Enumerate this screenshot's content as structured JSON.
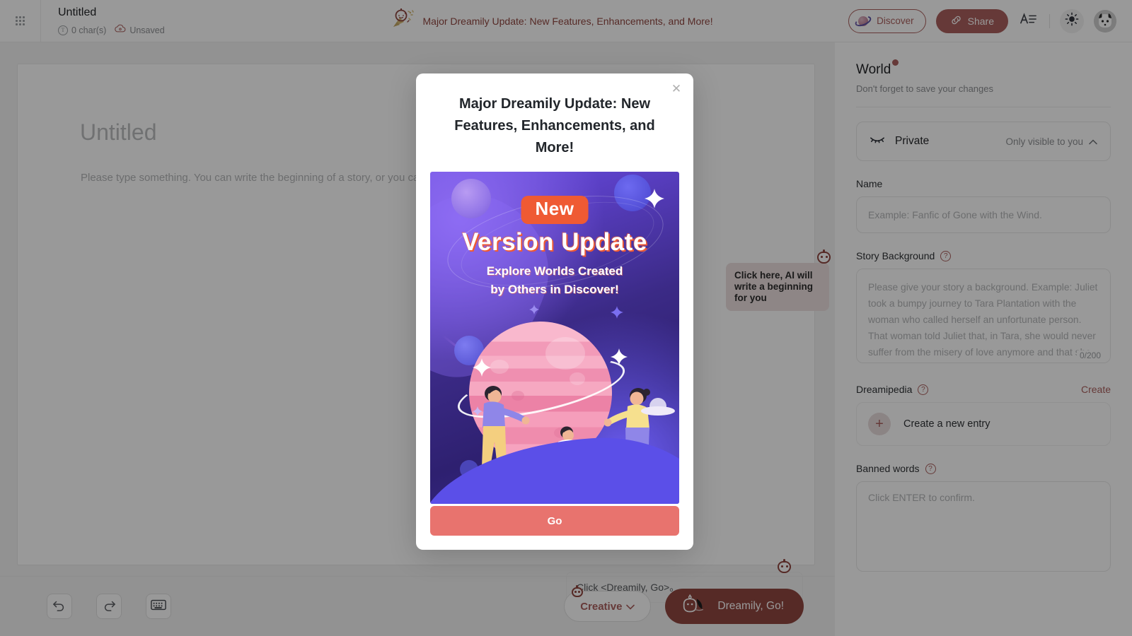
{
  "header": {
    "grid_icon": "app-grid-icon",
    "doc_title": "Untitled",
    "char_count": "0 char(s)",
    "save_status": "Unsaved",
    "banner_text": "Major Dreamily Update: New Features, Enhancements, and More!",
    "discover_label": "Discover",
    "share_label": "Share",
    "format_icon": "text-format-icon",
    "theme_icon": "brightness-icon",
    "avatar_icon": "user-avatar"
  },
  "editor": {
    "title_placeholder": "Untitled",
    "body_placeholder": "Please type something. You can write the beginning of a story, or you can write the description of a character.",
    "tip_ai": "Click here, AI will write a beginning for you",
    "tip_go": "Click <Dreamily, Go>。",
    "toolbar": {
      "undo_icon": "undo-icon",
      "redo_icon": "redo-icon",
      "keyboard_icon": "keyboard-icon",
      "creative_label": "Creative",
      "dreamily_go_label": "Dreamily, Go!"
    }
  },
  "sidebar": {
    "title": "World",
    "subtitle": "Don't forget to save your changes",
    "privacy": {
      "label": "Private",
      "hint": "Only visible to you",
      "icon": "eye-off-icon",
      "chevron": "chevron-up-icon"
    },
    "name": {
      "label": "Name",
      "value": "",
      "placeholder": "Example: Fanfic of Gone with the Wind."
    },
    "story_background": {
      "label": "Story Background",
      "help_icon": "question-icon",
      "value": "",
      "placeholder": "Please give your story a background. Example: Juliet took a bumpy journey to Tara Plantation with the woman who called herself an unfortunate person. That woman told Juliet that, in Tara, she would never suffer from the misery of love anymore and that she would be everything she wanted.",
      "counter": "0/200"
    },
    "dreamipedia": {
      "label": "Dreamipedia",
      "help_icon": "question-icon",
      "create_link": "Create",
      "entry_label": "Create a new entry",
      "plus_icon": "plus-icon"
    },
    "banned_words": {
      "label": "Banned words",
      "help_icon": "question-icon",
      "value": "",
      "placeholder": "Click ENTER to confirm."
    }
  },
  "modal": {
    "title": "Major Dreamily Update: New Features, Enhancements, and More!",
    "close_icon": "close-icon",
    "go_label": "Go",
    "promo": {
      "badge": "New",
      "headline": "Version Update",
      "subline_1": "Explore Worlds Created",
      "subline_2": "by Others in Discover!"
    }
  },
  "colors": {
    "brand_red": "#c0392f",
    "accent_red": "#d9534f",
    "modal_button": "#e8736e",
    "badge_orange": "#ef5a33",
    "space_purple": "#3b2a86",
    "planet_pink": "#f29ab8"
  }
}
